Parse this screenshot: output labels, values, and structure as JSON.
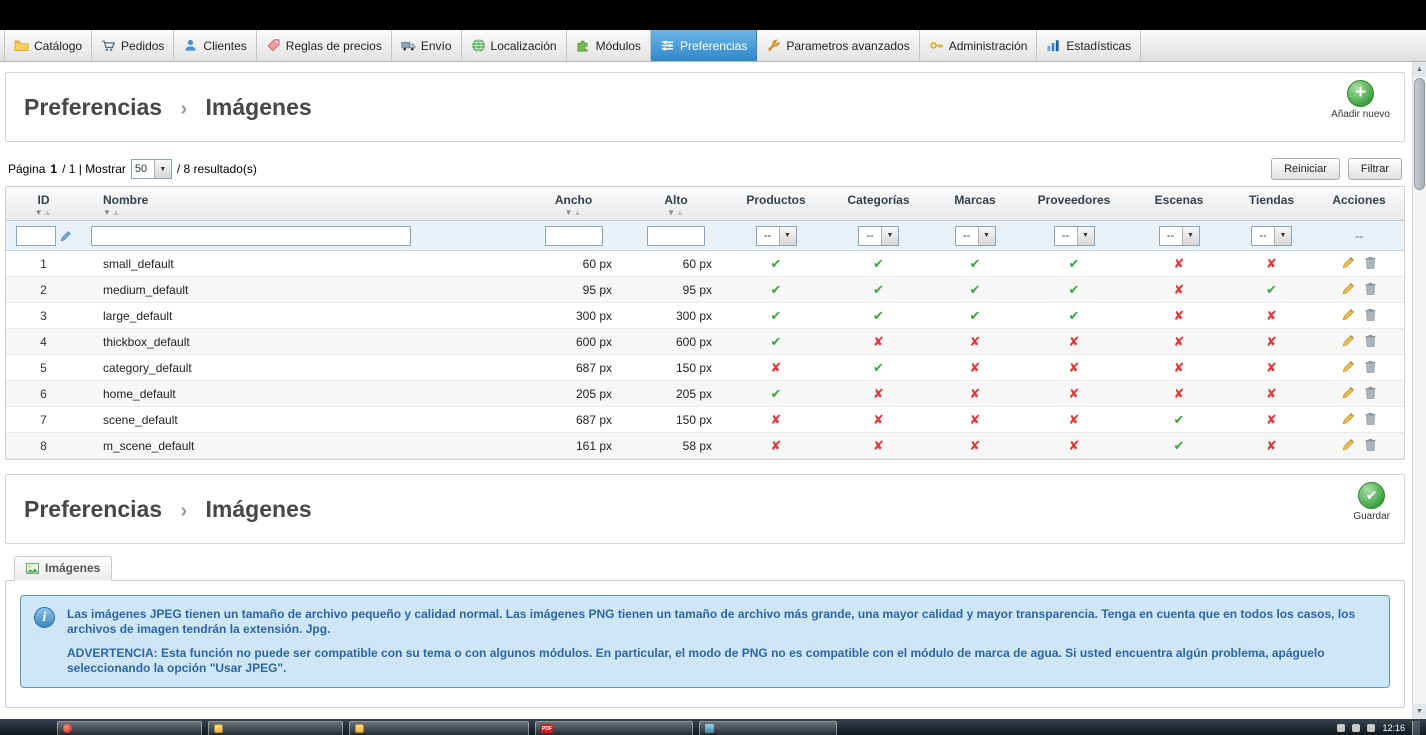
{
  "theme": {
    "active_tab_color": "#3a8ccb",
    "check_color": "#39a839",
    "cross_color": "#dd3b3b",
    "info_box_bg": "#cfe6f6",
    "info_text_color": "#2a66a5",
    "add_button_green": "#3aa03a"
  },
  "nav": {
    "tabs": [
      {
        "label": "Catálogo"
      },
      {
        "label": "Pedidos"
      },
      {
        "label": "Clientes"
      },
      {
        "label": "Reglas de precios"
      },
      {
        "label": "Envío"
      },
      {
        "label": "Localización"
      },
      {
        "label": "Módulos"
      },
      {
        "label": "Preferencias",
        "active": true
      },
      {
        "label": "Parametros avanzados"
      },
      {
        "label": "Administración"
      },
      {
        "label": "Estadísticas"
      }
    ]
  },
  "list_header": {
    "breadcrumb_parent": "Preferencias",
    "breadcrumb_separator": "›",
    "breadcrumb_current": "Imágenes",
    "add_new_label": "Añadir nuevo"
  },
  "pagination": {
    "page_word": "Página",
    "page_current": "1",
    "page_rest": "/ 1  |  Mostrar",
    "per_page": "50",
    "results_text": "/ 8 resultado(s)",
    "reset_label": "Reiniciar",
    "filter_label": "Filtrar"
  },
  "table": {
    "columns": [
      "ID",
      "Nombre",
      "Ancho",
      "Alto",
      "Productos",
      "Categorías",
      "Marcas",
      "Proveedores",
      "Escenas",
      "Tiendas",
      "Acciones"
    ],
    "filter_select_value": "--",
    "filter_actions_value": "--",
    "rows": [
      {
        "id": "1",
        "nombre": "small_default",
        "ancho": "60 px",
        "alto": "60 px",
        "productos": true,
        "categorias": true,
        "marcas": true,
        "proveedores": true,
        "escenas": false,
        "tiendas": false
      },
      {
        "id": "2",
        "nombre": "medium_default",
        "ancho": "95 px",
        "alto": "95 px",
        "productos": true,
        "categorias": true,
        "marcas": true,
        "proveedores": true,
        "escenas": false,
        "tiendas": true
      },
      {
        "id": "3",
        "nombre": "large_default",
        "ancho": "300 px",
        "alto": "300 px",
        "productos": true,
        "categorias": true,
        "marcas": true,
        "proveedores": true,
        "escenas": false,
        "tiendas": false
      },
      {
        "id": "4",
        "nombre": "thickbox_default",
        "ancho": "600 px",
        "alto": "600 px",
        "productos": true,
        "categorias": false,
        "marcas": false,
        "proveedores": false,
        "escenas": false,
        "tiendas": false
      },
      {
        "id": "5",
        "nombre": "category_default",
        "ancho": "687 px",
        "alto": "150 px",
        "productos": false,
        "categorias": true,
        "marcas": false,
        "proveedores": false,
        "escenas": false,
        "tiendas": false
      },
      {
        "id": "6",
        "nombre": "home_default",
        "ancho": "205 px",
        "alto": "205 px",
        "productos": true,
        "categorias": false,
        "marcas": false,
        "proveedores": false,
        "escenas": false,
        "tiendas": false
      },
      {
        "id": "7",
        "nombre": "scene_default",
        "ancho": "687 px",
        "alto": "150 px",
        "productos": false,
        "categorias": false,
        "marcas": false,
        "proveedores": false,
        "escenas": true,
        "tiendas": false
      },
      {
        "id": "8",
        "nombre": "m_scene_default",
        "ancho": "161 px",
        "alto": "58 px",
        "productos": false,
        "categorias": false,
        "marcas": false,
        "proveedores": false,
        "escenas": true,
        "tiendas": false
      }
    ]
  },
  "form_header": {
    "breadcrumb_parent": "Preferencias",
    "breadcrumb_separator": "›",
    "breadcrumb_current": "Imágenes",
    "save_label": "Guardar"
  },
  "form": {
    "legend": "Imágenes",
    "info_paragraphs": [
      "Las imágenes JPEG tienen un tamaño de archivo pequeño y calidad normal. Las imágenes PNG tienen un tamaño de archivo más grande, una mayor calidad y mayor transparencia. Tenga en cuenta que en todos los casos, los archivos de imagen tendrán la extensión. Jpg.",
      "ADVERTENCIA: Esta función no puede ser compatible con su tema o con algunos módulos. En particular, el modo de PNG no es compatible con el módulo de marca de agua. Si usted encuentra algún problema, apáguelo seleccionando la opción \"Usar JPEG\"."
    ]
  },
  "taskbar": {
    "pdf_label": "PDF",
    "clock": "12:16"
  }
}
